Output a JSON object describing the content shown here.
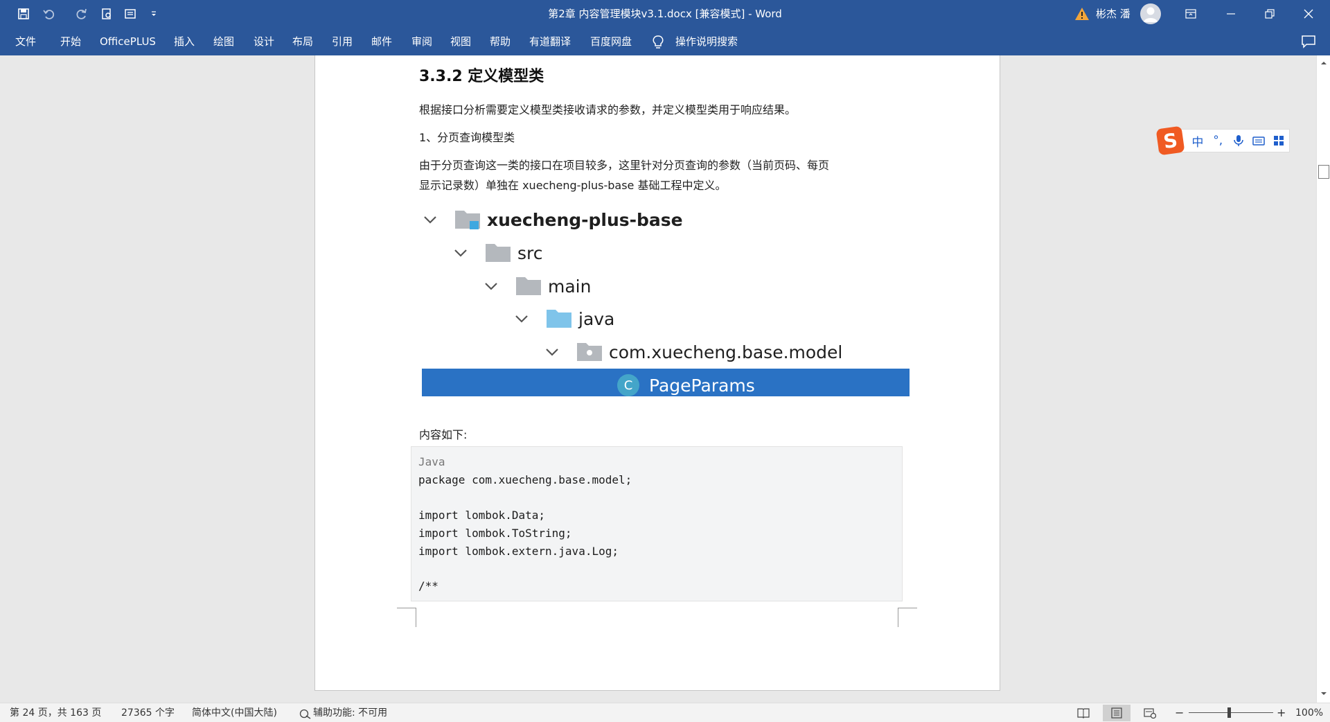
{
  "title_bar": {
    "document_title": "第2章 内容管理模块v3.1.docx [兼容模式]  -  Word",
    "user_name": "彬杰 潘",
    "quick_access": [
      "save-icon",
      "undo-icon",
      "redo-icon",
      "print-preview-icon",
      "format-icon",
      "customize-dropdown-icon"
    ],
    "window_controls": [
      "ribbon-display-options-icon",
      "minimize-icon",
      "restore-icon",
      "close-icon"
    ]
  },
  "ribbon": {
    "tabs": [
      "文件",
      "开始",
      "OfficePLUS",
      "插入",
      "绘图",
      "设计",
      "布局",
      "引用",
      "邮件",
      "审阅",
      "视图",
      "帮助",
      "有道翻译",
      "百度网盘"
    ],
    "tell_me": "操作说明搜索"
  },
  "document": {
    "heading": "3.3.2 定义模型类",
    "paragraphs": [
      "根据接口分析需要定义模型类接收请求的参数，并定义模型类用于响应结果。",
      "1、分页查询模型类",
      "由于分页查询这一类的接口在项目较多，这里针对分页查询的参数（当前页码、每页",
      "显示记录数）单独在 xuecheng-plus-base 基础工程中定义。"
    ],
    "tree": [
      {
        "label": "xuecheng-plus-base",
        "icon": "module-folder-icon",
        "bold": true
      },
      {
        "label": "src",
        "icon": "folder-icon",
        "bold": false
      },
      {
        "label": "main",
        "icon": "folder-icon",
        "bold": false
      },
      {
        "label": "java",
        "icon": "source-folder-icon",
        "bold": false
      },
      {
        "label": "com.xuecheng.base.model",
        "icon": "package-icon",
        "bold": false
      },
      {
        "label": "PageParams",
        "icon": "class-icon",
        "badge": "C",
        "selected": true
      }
    ],
    "content_intro": "内容如下:",
    "code": {
      "language": "Java",
      "lines": [
        "package com.xuecheng.base.model;",
        "",
        "import lombok.Data;",
        "import lombok.ToString;",
        "import lombok.extern.java.Log;",
        "",
        "/**"
      ]
    }
  },
  "ime": {
    "logo": "S",
    "mode": "中",
    "punctuation": "°,"
  },
  "status_bar": {
    "page": "第 24 页，共 163 页",
    "words": "27365 个字",
    "language": "简体中文(中国大陆)",
    "accessibility": "辅助功能: 不可用",
    "zoom": "100%",
    "zoom_minus": "−",
    "zoom_plus": "+"
  },
  "colors": {
    "ribbon": "#2b579a",
    "selection": "#2a72c4",
    "class_badge": "#44a5c9",
    "ime_logo": "#f05a22"
  }
}
